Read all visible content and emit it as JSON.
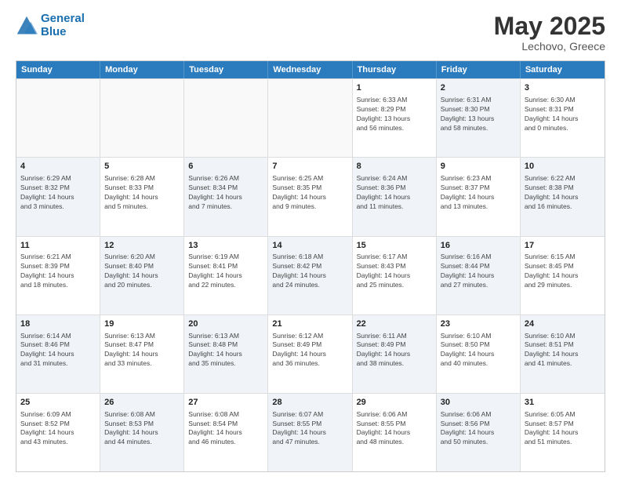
{
  "header": {
    "logo_line1": "General",
    "logo_line2": "Blue",
    "month": "May 2025",
    "location": "Lechovo, Greece"
  },
  "weekdays": [
    "Sunday",
    "Monday",
    "Tuesday",
    "Wednesday",
    "Thursday",
    "Friday",
    "Saturday"
  ],
  "rows": [
    [
      {
        "day": "",
        "text": "",
        "shaded": false
      },
      {
        "day": "",
        "text": "",
        "shaded": false
      },
      {
        "day": "",
        "text": "",
        "shaded": false
      },
      {
        "day": "",
        "text": "",
        "shaded": false
      },
      {
        "day": "1",
        "text": "Sunrise: 6:33 AM\nSunset: 8:29 PM\nDaylight: 13 hours\nand 56 minutes.",
        "shaded": false
      },
      {
        "day": "2",
        "text": "Sunrise: 6:31 AM\nSunset: 8:30 PM\nDaylight: 13 hours\nand 58 minutes.",
        "shaded": true
      },
      {
        "day": "3",
        "text": "Sunrise: 6:30 AM\nSunset: 8:31 PM\nDaylight: 14 hours\nand 0 minutes.",
        "shaded": false
      }
    ],
    [
      {
        "day": "4",
        "text": "Sunrise: 6:29 AM\nSunset: 8:32 PM\nDaylight: 14 hours\nand 3 minutes.",
        "shaded": true
      },
      {
        "day": "5",
        "text": "Sunrise: 6:28 AM\nSunset: 8:33 PM\nDaylight: 14 hours\nand 5 minutes.",
        "shaded": false
      },
      {
        "day": "6",
        "text": "Sunrise: 6:26 AM\nSunset: 8:34 PM\nDaylight: 14 hours\nand 7 minutes.",
        "shaded": true
      },
      {
        "day": "7",
        "text": "Sunrise: 6:25 AM\nSunset: 8:35 PM\nDaylight: 14 hours\nand 9 minutes.",
        "shaded": false
      },
      {
        "day": "8",
        "text": "Sunrise: 6:24 AM\nSunset: 8:36 PM\nDaylight: 14 hours\nand 11 minutes.",
        "shaded": true
      },
      {
        "day": "9",
        "text": "Sunrise: 6:23 AM\nSunset: 8:37 PM\nDaylight: 14 hours\nand 13 minutes.",
        "shaded": false
      },
      {
        "day": "10",
        "text": "Sunrise: 6:22 AM\nSunset: 8:38 PM\nDaylight: 14 hours\nand 16 minutes.",
        "shaded": true
      }
    ],
    [
      {
        "day": "11",
        "text": "Sunrise: 6:21 AM\nSunset: 8:39 PM\nDaylight: 14 hours\nand 18 minutes.",
        "shaded": false
      },
      {
        "day": "12",
        "text": "Sunrise: 6:20 AM\nSunset: 8:40 PM\nDaylight: 14 hours\nand 20 minutes.",
        "shaded": true
      },
      {
        "day": "13",
        "text": "Sunrise: 6:19 AM\nSunset: 8:41 PM\nDaylight: 14 hours\nand 22 minutes.",
        "shaded": false
      },
      {
        "day": "14",
        "text": "Sunrise: 6:18 AM\nSunset: 8:42 PM\nDaylight: 14 hours\nand 24 minutes.",
        "shaded": true
      },
      {
        "day": "15",
        "text": "Sunrise: 6:17 AM\nSunset: 8:43 PM\nDaylight: 14 hours\nand 25 minutes.",
        "shaded": false
      },
      {
        "day": "16",
        "text": "Sunrise: 6:16 AM\nSunset: 8:44 PM\nDaylight: 14 hours\nand 27 minutes.",
        "shaded": true
      },
      {
        "day": "17",
        "text": "Sunrise: 6:15 AM\nSunset: 8:45 PM\nDaylight: 14 hours\nand 29 minutes.",
        "shaded": false
      }
    ],
    [
      {
        "day": "18",
        "text": "Sunrise: 6:14 AM\nSunset: 8:46 PM\nDaylight: 14 hours\nand 31 minutes.",
        "shaded": true
      },
      {
        "day": "19",
        "text": "Sunrise: 6:13 AM\nSunset: 8:47 PM\nDaylight: 14 hours\nand 33 minutes.",
        "shaded": false
      },
      {
        "day": "20",
        "text": "Sunrise: 6:13 AM\nSunset: 8:48 PM\nDaylight: 14 hours\nand 35 minutes.",
        "shaded": true
      },
      {
        "day": "21",
        "text": "Sunrise: 6:12 AM\nSunset: 8:49 PM\nDaylight: 14 hours\nand 36 minutes.",
        "shaded": false
      },
      {
        "day": "22",
        "text": "Sunrise: 6:11 AM\nSunset: 8:49 PM\nDaylight: 14 hours\nand 38 minutes.",
        "shaded": true
      },
      {
        "day": "23",
        "text": "Sunrise: 6:10 AM\nSunset: 8:50 PM\nDaylight: 14 hours\nand 40 minutes.",
        "shaded": false
      },
      {
        "day": "24",
        "text": "Sunrise: 6:10 AM\nSunset: 8:51 PM\nDaylight: 14 hours\nand 41 minutes.",
        "shaded": true
      }
    ],
    [
      {
        "day": "25",
        "text": "Sunrise: 6:09 AM\nSunset: 8:52 PM\nDaylight: 14 hours\nand 43 minutes.",
        "shaded": false
      },
      {
        "day": "26",
        "text": "Sunrise: 6:08 AM\nSunset: 8:53 PM\nDaylight: 14 hours\nand 44 minutes.",
        "shaded": true
      },
      {
        "day": "27",
        "text": "Sunrise: 6:08 AM\nSunset: 8:54 PM\nDaylight: 14 hours\nand 46 minutes.",
        "shaded": false
      },
      {
        "day": "28",
        "text": "Sunrise: 6:07 AM\nSunset: 8:55 PM\nDaylight: 14 hours\nand 47 minutes.",
        "shaded": true
      },
      {
        "day": "29",
        "text": "Sunrise: 6:06 AM\nSunset: 8:55 PM\nDaylight: 14 hours\nand 48 minutes.",
        "shaded": false
      },
      {
        "day": "30",
        "text": "Sunrise: 6:06 AM\nSunset: 8:56 PM\nDaylight: 14 hours\nand 50 minutes.",
        "shaded": true
      },
      {
        "day": "31",
        "text": "Sunrise: 6:05 AM\nSunset: 8:57 PM\nDaylight: 14 hours\nand 51 minutes.",
        "shaded": false
      }
    ]
  ]
}
